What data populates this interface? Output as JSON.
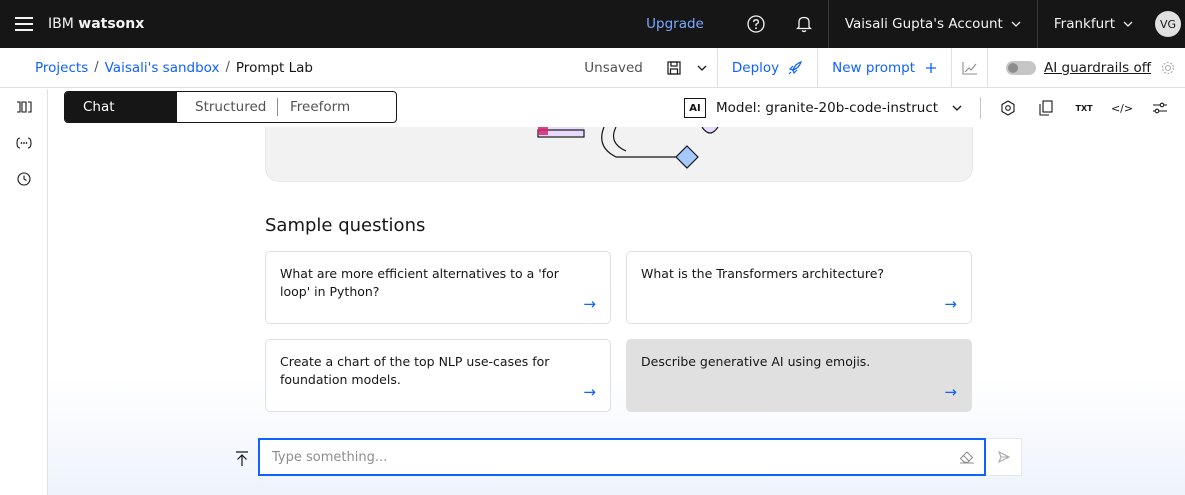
{
  "topbar": {
    "brand_prefix": "IBM",
    "brand_product": "watsonx",
    "upgrade_label": "Upgrade",
    "account_label": "Vaisali Gupta's Account",
    "region_label": "Frankfurt",
    "avatar_initials": "VG",
    "icons": [
      "menu-icon",
      "help-icon",
      "notification-icon",
      "chevron-down-icon"
    ]
  },
  "breadcrumb": {
    "items": [
      "Projects",
      "Vaisali's sandbox"
    ],
    "separator": "/",
    "current": "Prompt Lab"
  },
  "actions": {
    "status": "Unsaved",
    "deploy_label": "Deploy",
    "new_prompt_label": "New prompt",
    "guardrails_label": "AI guardrails off"
  },
  "tabs": [
    {
      "label": "Chat",
      "active": true
    },
    {
      "label": "Structured",
      "active": false
    },
    {
      "label": "Freeform",
      "active": false
    }
  ],
  "model": {
    "badge": "AI",
    "label": "Model: granite-20b-code-instruct"
  },
  "toolbar_icons": {
    "txt_label": "TXT",
    "code_label": "</>"
  },
  "sample_questions": {
    "title": "Sample questions",
    "items": [
      "What are more efficient alternatives to a 'for loop' in Python?",
      "What is the Transformers architecture?",
      "Create a chart of the top NLP use-cases for foundation models.",
      "Describe generative AI using emojis."
    ],
    "arrow": "→"
  },
  "composer": {
    "placeholder": "Type something...",
    "value": ""
  },
  "colors": {
    "topbar_bg": "#161616",
    "link_blue": "#0f62fe",
    "upgrade_blue": "#78a9ff",
    "card_highlight": "#e0e0e0"
  }
}
